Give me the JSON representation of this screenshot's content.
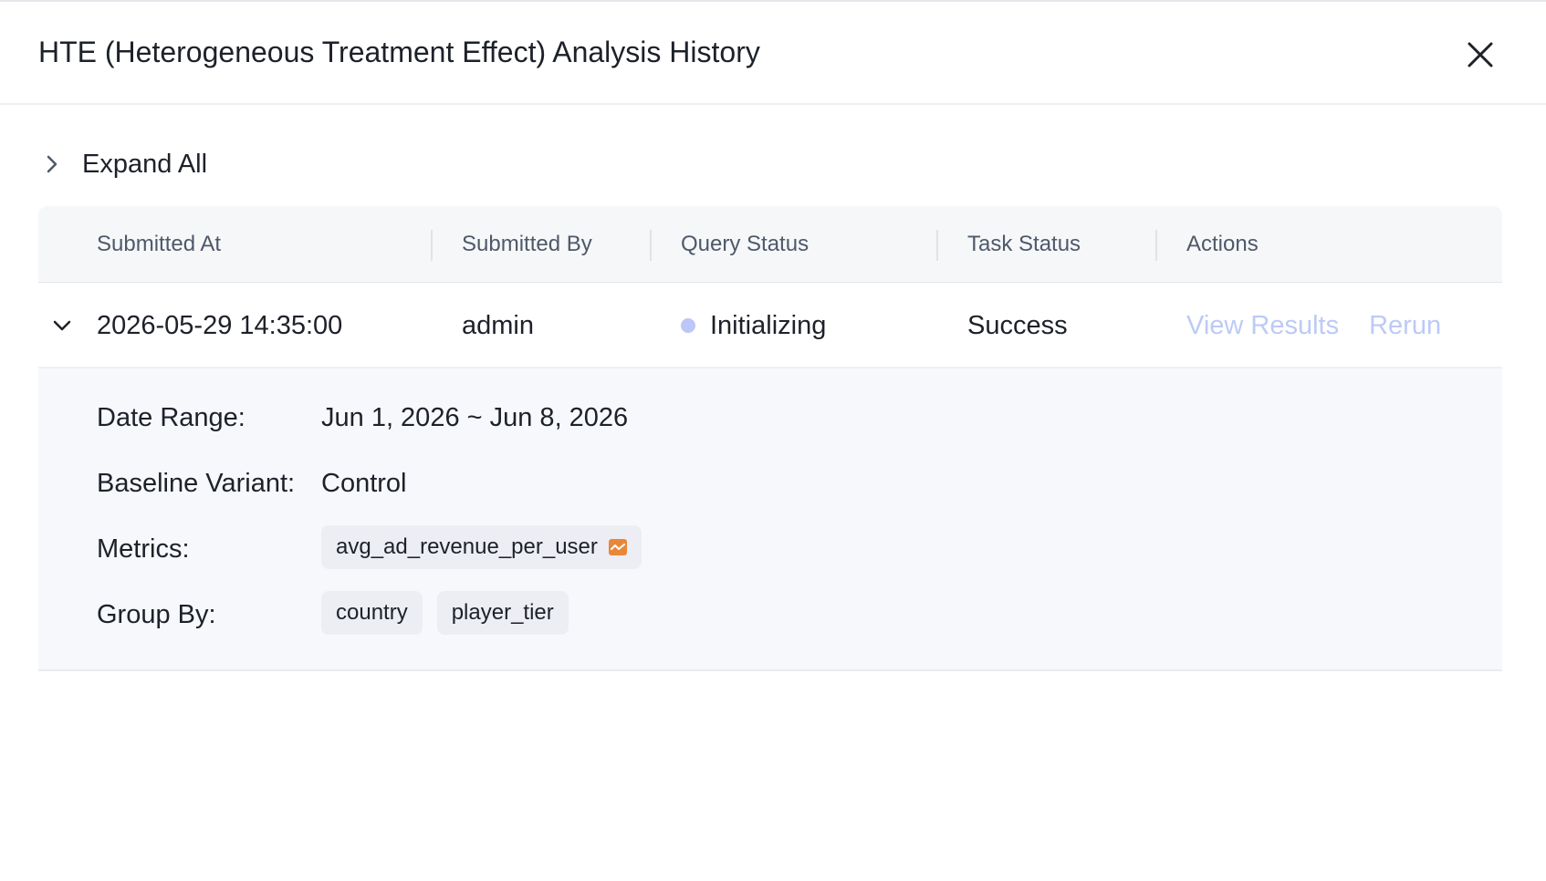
{
  "modal": {
    "title": "HTE (Heterogeneous Treatment Effect) Analysis History"
  },
  "toolbar": {
    "expand_all_label": "Expand All"
  },
  "table": {
    "columns": [
      "Submitted At",
      "Submitted By",
      "Query Status",
      "Task Status",
      "Actions"
    ],
    "rows": [
      {
        "submitted_at": "2026-05-29 14:35:00",
        "submitted_by": "admin",
        "query_status": "Initializing",
        "task_status": "Success",
        "actions": [
          "View Results",
          "Rerun"
        ],
        "expanded": true,
        "details": {
          "date_range_label": "Date Range:",
          "date_range_value": "Jun 1, 2026 ~ Jun 8, 2026",
          "baseline_label": "Baseline Variant:",
          "baseline_value": "Control",
          "metrics_label": "Metrics:",
          "metrics": [
            "avg_ad_revenue_per_user"
          ],
          "group_by_label": "Group By:",
          "group_by": [
            "country",
            "player_tier"
          ]
        }
      }
    ]
  },
  "colors": {
    "status_dot": "#bcc6f7",
    "action_link_disabled": "#bccaf5",
    "metric_icon": "#e8873a",
    "header_bg": "#f6f7f9",
    "detail_bg": "#f7f8fc"
  },
  "icons": {
    "close": "close-icon",
    "expand_all": "chevron-right-icon",
    "row_toggle": "chevron-down-icon",
    "metric": "metric-chart-icon"
  }
}
